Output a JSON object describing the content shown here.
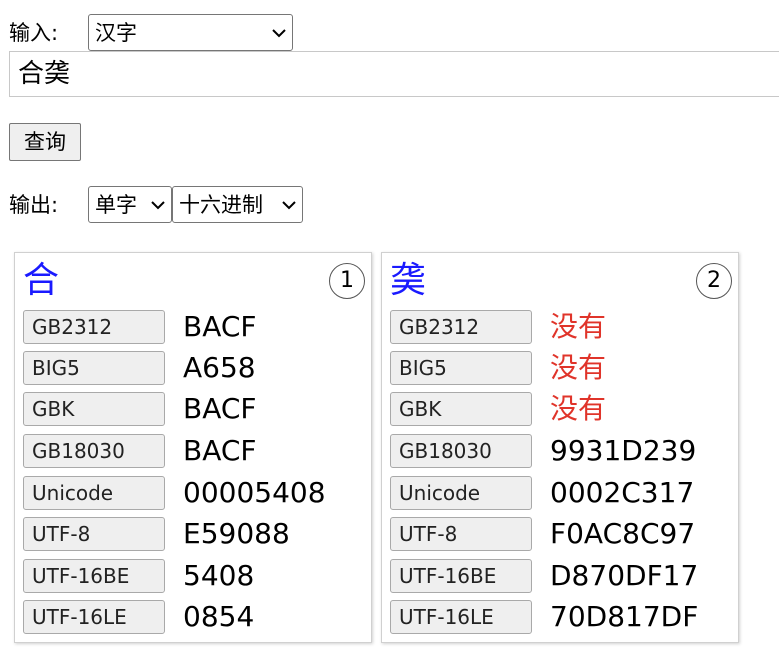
{
  "input_section": {
    "label": "输入:",
    "type_select": "汉字",
    "text_value": "合䶮"
  },
  "query_button": "查询",
  "output_section": {
    "label": "输出:",
    "mode_select": "单字",
    "format_select": "十六进制"
  },
  "cards": [
    {
      "char": "合",
      "index": "1",
      "rows": [
        {
          "label": "GB2312",
          "value": "BACF",
          "missing": false
        },
        {
          "label": "BIG5",
          "value": "A658",
          "missing": false
        },
        {
          "label": "GBK",
          "value": "BACF",
          "missing": false
        },
        {
          "label": "GB18030",
          "value": "BACF",
          "missing": false
        },
        {
          "label": "Unicode",
          "value": "00005408",
          "missing": false
        },
        {
          "label": "UTF-8",
          "value": "E59088",
          "missing": false
        },
        {
          "label": "UTF-16BE",
          "value": "5408",
          "missing": false
        },
        {
          "label": "UTF-16LE",
          "value": "0854",
          "missing": false
        }
      ]
    },
    {
      "char": "䶮",
      "index": "2",
      "rows": [
        {
          "label": "GB2312",
          "value": "没有",
          "missing": true
        },
        {
          "label": "BIG5",
          "value": "没有",
          "missing": true
        },
        {
          "label": "GBK",
          "value": "没有",
          "missing": true
        },
        {
          "label": "GB18030",
          "value": "9931D239",
          "missing": false
        },
        {
          "label": "Unicode",
          "value": "0002C317",
          "missing": false
        },
        {
          "label": "UTF-8",
          "value": "F0AC8C97",
          "missing": false
        },
        {
          "label": "UTF-16BE",
          "value": "D870DF17",
          "missing": false
        },
        {
          "label": "UTF-16LE",
          "value": "70D817DF",
          "missing": false
        }
      ]
    }
  ],
  "colors": {
    "char_color": "#1a1aff",
    "missing_color": "#e0342a"
  }
}
